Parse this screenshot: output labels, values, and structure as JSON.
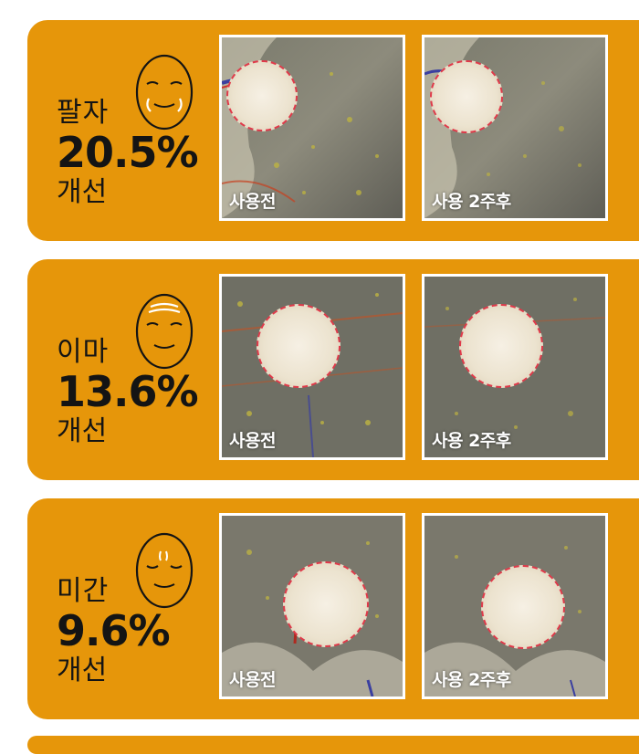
{
  "colors": {
    "panel": "#E6960A",
    "text": "#141414",
    "zoom_border": "#e03a4a"
  },
  "panels": [
    {
      "icon": "smile-lines-face-icon",
      "area": "팔자",
      "percent": "20.5%",
      "suffix": "개선",
      "before_label": "사용전",
      "after_label": "사용 2주후"
    },
    {
      "icon": "forehead-lines-face-icon",
      "area": "이마",
      "percent": "13.6%",
      "suffix": "개선",
      "before_label": "사용전",
      "after_label": "사용 2주후"
    },
    {
      "icon": "glabella-lines-face-icon",
      "area": "미간",
      "percent": "9.6%",
      "suffix": "개선",
      "before_label": "사용전",
      "after_label": "사용 2주후"
    }
  ]
}
